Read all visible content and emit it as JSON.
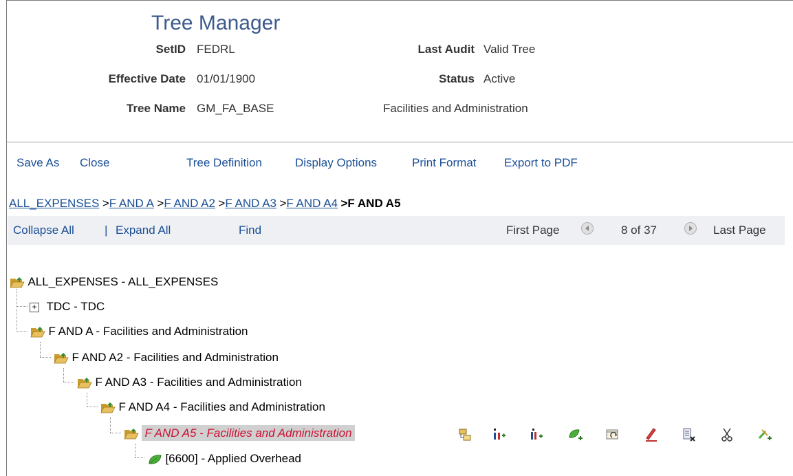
{
  "header": {
    "title": "Tree Manager",
    "setid_label": "SetID",
    "setid_value": "FEDRL",
    "last_audit_label": "Last Audit",
    "last_audit_value": "Valid Tree",
    "eff_date_label": "Effective Date",
    "eff_date_value": "01/01/1900",
    "status_label": "Status",
    "status_value": "Active",
    "tree_name_label": "Tree Name",
    "tree_name_value": "GM_FA_BASE",
    "tree_desc": "Facilities and Administration"
  },
  "toolbar": {
    "save_as": "Save As",
    "close": "Close",
    "tree_definition": "Tree Definition",
    "display_options": "Display Options",
    "print_format": "Print Format",
    "export_pdf": "Export to PDF"
  },
  "breadcrumb": {
    "items": [
      "ALL_EXPENSES",
      "F AND A",
      "F AND A2",
      "F AND A3",
      "F AND A4"
    ],
    "sep": ">",
    "current": ">F AND A5"
  },
  "navbar": {
    "collapse_all": "Collapse All",
    "divider": "|",
    "expand_all": "Expand All",
    "find": "Find",
    "first_page": "First Page",
    "page_info": "8 of 37",
    "last_page": "Last Page"
  },
  "tree": {
    "root": "ALL_EXPENSES - ALL_EXPENSES",
    "tdc": "TDC - TDC",
    "fa": "F AND A - Facilities and Administration",
    "fa2": "F AND A2 - Facilities and Administration",
    "fa3": "F AND A3 - Facilities and Administration",
    "fa4": "F AND A4 - Facilities and Administration",
    "fa5": "F AND A5 - Facilities and Administration",
    "leaf": "[6600] - Applied Overhead"
  },
  "node_actions": [
    "insert-sibling-node-icon",
    "insert-child-detail-icon",
    "insert-sibling-detail-icon",
    "insert-leaf-icon",
    "move-node-icon",
    "edit-node-icon",
    "delete-node-icon",
    "cut-icon",
    "paste-icon"
  ],
  "colors": {
    "title": "#3c5a8c",
    "link": "#1a4f96",
    "selected_text": "#cc1133",
    "folder": "#e8c060"
  }
}
